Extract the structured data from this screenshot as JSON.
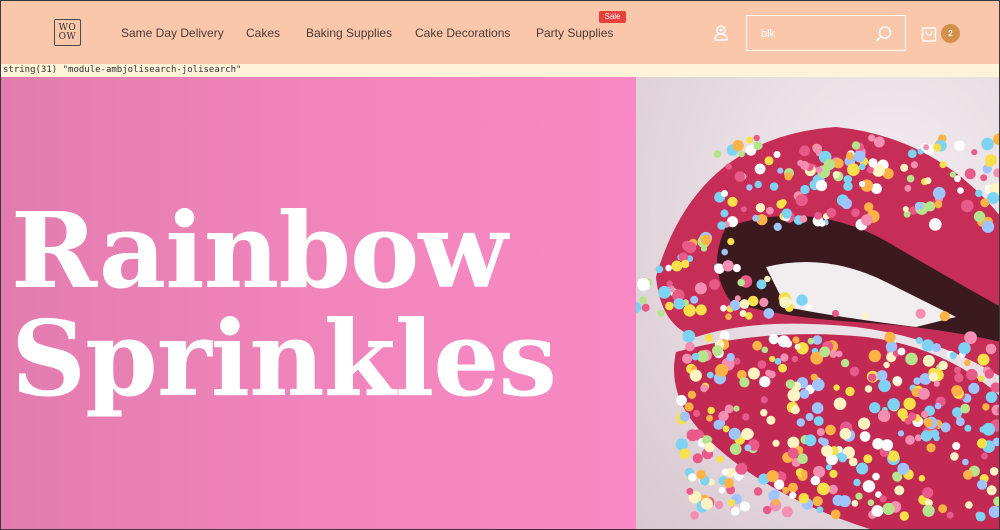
{
  "logo": {
    "line1": "WO",
    "line2": "OW"
  },
  "nav": {
    "items": [
      {
        "label": "Same Day Delivery"
      },
      {
        "label": "Cakes"
      },
      {
        "label": "Baking Supplies"
      },
      {
        "label": "Cake Decorations"
      },
      {
        "label": "Party Supplies"
      }
    ],
    "sale_badge": "Sale"
  },
  "search": {
    "value": "blk",
    "placeholder": ""
  },
  "cart": {
    "count": "2"
  },
  "debug": "string(31) \"module-ambjolisearch-jolisearch\"",
  "hero": {
    "title_line1": "Rainbow",
    "title_line2": "Sprinkles"
  },
  "colors": {
    "header_bg": "#fbc7ab",
    "hero_pink": "#f186bc",
    "sale_red": "#e8403a",
    "cart_badge": "#d4914a"
  },
  "icons": {
    "user": "user-icon",
    "search": "search-icon",
    "cart": "cart-icon"
  }
}
